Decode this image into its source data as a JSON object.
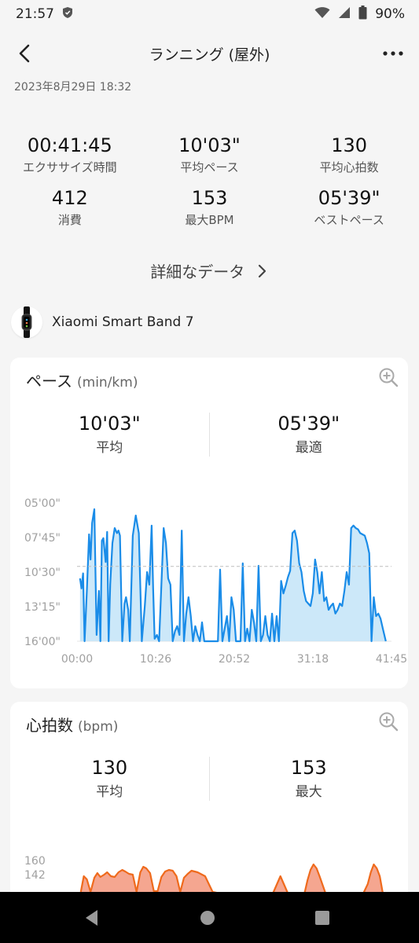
{
  "status_bar": {
    "time": "21:57",
    "battery": "90%"
  },
  "header": {
    "title": "ランニング (屋外)"
  },
  "workout": {
    "datetime": "2023年8月29日 18:32"
  },
  "summary": [
    {
      "value": "00:41:45",
      "label": "エクササイズ時間"
    },
    {
      "value": "10'03\"",
      "label": "平均ペース"
    },
    {
      "value": "130",
      "label": "平均心拍数"
    },
    {
      "value": "412",
      "label": "消費"
    },
    {
      "value": "153",
      "label": "最大BPM"
    },
    {
      "value": "05'39\"",
      "label": "ベストペース"
    }
  ],
  "detail_link": "詳細なデータ",
  "device": {
    "name": "Xiaomi Smart Band 7"
  },
  "pace_card": {
    "title": "ペース",
    "unit": "(min/km)",
    "avg_value": "10'03\"",
    "avg_label": "平均",
    "best_value": "05'39\"",
    "best_label": "最適"
  },
  "hr_card": {
    "title": "心拍数",
    "unit": "(bpm)",
    "avg_value": "130",
    "avg_label": "平均",
    "max_value": "153",
    "max_label": "最大"
  },
  "chart_data": [
    {
      "type": "area",
      "y_tick_labels": [
        "05'00\"",
        "07'45\"",
        "10'30\"",
        "13'15\"",
        "16'00\""
      ],
      "x_tick_labels": [
        "00:00",
        "10:26",
        "20:52",
        "31:18",
        "41:45"
      ],
      "xlim": [
        0,
        41.75
      ],
      "ylim": [
        5,
        16
      ],
      "y_inverted": true,
      "average_line": 10.05,
      "color": "#1a8ce8",
      "fill": "#bfe2f7",
      "x": [
        0.4,
        0.6,
        0.8,
        1.0,
        1.3,
        1.6,
        1.8,
        2.0,
        2.3,
        2.6,
        2.9,
        3.1,
        3.3,
        3.5,
        3.8,
        4.0,
        4.2,
        4.4,
        4.7,
        5.0,
        5.3,
        5.5,
        5.7,
        6.0,
        6.3,
        6.5,
        6.8,
        7.0,
        7.4,
        7.8,
        8.2,
        8.6,
        9.0,
        9.3,
        9.6,
        9.9,
        10.1,
        10.3,
        10.6,
        10.9,
        11.2,
        11.5,
        11.8,
        12.1,
        12.4,
        12.7,
        13.0,
        13.3,
        13.6,
        13.9,
        14.2,
        14.5,
        14.8,
        15.1,
        15.4,
        15.7,
        16.0,
        16.3,
        16.6,
        16.9,
        17.2,
        17.5,
        17.8,
        18.1,
        18.4,
        18.7,
        19.0,
        19.3,
        19.6,
        19.9,
        20.2,
        20.5,
        20.8,
        21.1,
        21.4,
        21.7,
        22.0,
        22.3,
        22.6,
        22.9,
        23.2,
        23.5,
        23.8,
        24.1,
        24.4,
        24.7,
        25.0,
        25.3,
        25.6,
        25.9,
        26.2,
        26.5,
        26.8,
        27.1,
        27.4,
        27.7,
        28.0,
        28.3,
        28.6,
        28.9,
        29.2,
        29.5,
        29.8,
        30.1,
        30.4,
        30.7,
        31.0,
        31.3,
        31.6,
        31.9,
        32.2,
        32.5,
        32.8,
        33.1,
        33.4,
        33.7,
        34.0,
        34.3,
        34.6,
        34.9,
        35.2,
        35.5,
        35.8,
        36.1,
        36.4,
        36.7,
        37.0,
        37.3,
        37.6,
        37.9,
        38.2,
        38.5,
        38.8,
        39.1,
        39.4,
        39.7,
        40.0,
        40.3,
        40.6,
        41.0,
        41.4
      ],
      "values": [
        11.0,
        11.8,
        10.6,
        16.0,
        12.0,
        7.5,
        9.5,
        6.6,
        5.5,
        15.5,
        12.0,
        16.0,
        8.0,
        7.8,
        9.7,
        7.3,
        16.0,
        11.5,
        8.2,
        7.0,
        7.4,
        7.2,
        7.6,
        16.0,
        13.0,
        12.5,
        13.5,
        16.0,
        7.6,
        6.0,
        7.4,
        16.0,
        13.2,
        10.5,
        11.5,
        6.8,
        11.8,
        15.8,
        15.5,
        16.0,
        11.5,
        7.0,
        8.2,
        11.0,
        11.5,
        16.0,
        15.2,
        14.8,
        15.5,
        7.2,
        16.0,
        13.8,
        12.5,
        14.0,
        16.0,
        14.8,
        15.5,
        16.0,
        14.5,
        16.0,
        16.0,
        16.0,
        16.0,
        16.0,
        16.0,
        16.0,
        10.3,
        16.0,
        15.0,
        14.0,
        16.0,
        12.5,
        13.5,
        16.0,
        16.0,
        16.0,
        9.8,
        16.0,
        15.0,
        16.0,
        13.5,
        14.5,
        16.0,
        10.0,
        16.0,
        15.5,
        14.0,
        15.5,
        16.0,
        13.8,
        16.0,
        14.0,
        16.0,
        11.2,
        12.2,
        11.6,
        10.9,
        10.4,
        7.4,
        7.2,
        8.0,
        9.8,
        10.5,
        12.0,
        12.8,
        13.0,
        13.2,
        12.2,
        9.5,
        10.5,
        12.2,
        10.5,
        12.8,
        12.5,
        13.5,
        13.2,
        13.0,
        13.8,
        13.5,
        13.0,
        13.2,
        12.0,
        10.5,
        11.5,
        7.0,
        6.8,
        7.0,
        7.1,
        7.4,
        7.5,
        7.6,
        8.2,
        9.0,
        16.0,
        12.5,
        14.0,
        13.8,
        14.2,
        15.0,
        16.0
      ]
    },
    {
      "type": "area",
      "y_tick_labels": [
        "160",
        "142"
      ],
      "ylim": [
        120,
        165
      ],
      "color": "#ef6a1c",
      "fill": "#f5a690",
      "x": [
        0.5,
        0.9,
        1.3,
        1.8,
        2.3,
        2.7,
        3.1,
        3.6,
        4.0,
        4.5,
        5.0,
        5.5,
        6.0,
        6.4,
        6.9,
        7.4,
        7.9,
        8.4,
        8.8,
        9.2,
        9.7,
        10.2,
        10.7,
        11.2,
        11.7,
        12.2,
        12.7,
        13.2,
        13.7,
        14.2,
        14.7,
        15.2,
        16.0,
        17.0,
        18.0,
        19.0,
        20.0,
        21.0,
        22.0,
        23.0,
        24.0,
        25.0,
        26.0,
        27.0,
        28.0,
        28.6,
        29.0,
        29.4,
        29.8,
        30.2,
        30.6,
        31.0,
        31.4,
        31.8,
        32.2,
        33.0,
        34.0,
        35.0,
        36.0,
        37.0,
        38.0,
        38.6,
        39.0,
        39.4,
        39.8,
        40.2,
        40.6,
        41.0,
        41.4
      ],
      "values": [
        120,
        140,
        136,
        120,
        138,
        144,
        139,
        142,
        145,
        140,
        139,
        145,
        148,
        146,
        143,
        142,
        120,
        145,
        152,
        150,
        144,
        121,
        121,
        139,
        146,
        148,
        147,
        140,
        120,
        138,
        143,
        147,
        145,
        140,
        120,
        118,
        118,
        118,
        118,
        118,
        118,
        118,
        118,
        140,
        118,
        118,
        118,
        118,
        118,
        118,
        135,
        148,
        155,
        150,
        140,
        118,
        118,
        118,
        118,
        118,
        118,
        130,
        145,
        155,
        150,
        140,
        118,
        118,
        118
      ]
    }
  ]
}
